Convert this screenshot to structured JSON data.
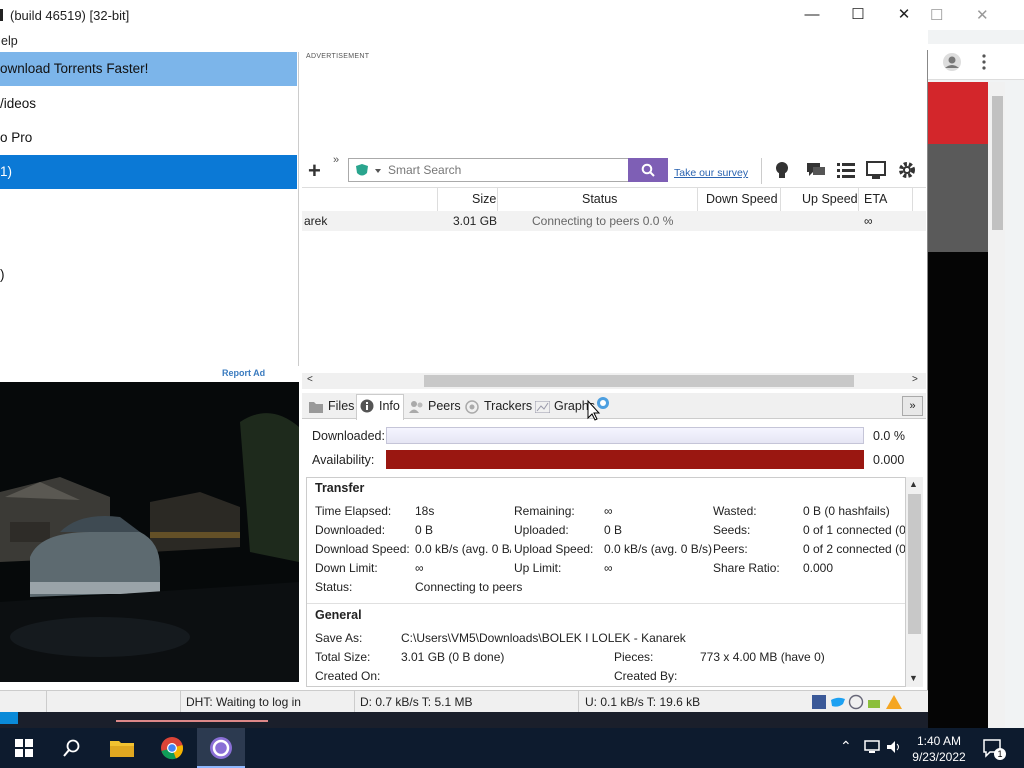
{
  "window": {
    "title": "(build 46519) [32-bit]",
    "minimize": "—",
    "maximize": "☐",
    "close": "✕",
    "menu_help": "Help"
  },
  "sidebar": {
    "items": [
      {
        "label": "ownload Torrents Faster!"
      },
      {
        "label": "/ideos"
      },
      {
        "label": "o Pro"
      },
      {
        "label": "1)"
      },
      {
        "label": ")"
      }
    ],
    "report_ad": "Report Ad"
  },
  "ad": {
    "label": "ADVERTISEMENT"
  },
  "toolbar": {
    "search_placeholder": "Smart Search",
    "survey_link": "Take our survey"
  },
  "torrent_list": {
    "headers": [
      "Size",
      "Status",
      "Down Speed",
      "Up Speed",
      "ETA"
    ],
    "row": {
      "name": "arek",
      "size": "3.01 GB",
      "status": "Connecting to peers 0.0 %",
      "eta": "∞"
    }
  },
  "tabs": {
    "files": "Files",
    "info": "Info",
    "peers": "Peers",
    "trackers": "Trackers",
    "graphs": "Graphs"
  },
  "progress": {
    "downloaded_label": "Downloaded:",
    "downloaded_value": "0.0 %",
    "downloaded_fraction": 0.0,
    "availability_label": "Availability:",
    "availability_value": "0.000"
  },
  "transfer": {
    "heading": "Transfer",
    "time_elapsed_label": "Time Elapsed:",
    "time_elapsed": "18s",
    "downloaded_label": "Downloaded:",
    "downloaded": "0 B",
    "download_speed_label": "Download Speed:",
    "download_speed": "0.0 kB/s (avg. 0 B/s",
    "down_limit_label": "Down Limit:",
    "down_limit": "∞",
    "status_label": "Status:",
    "status": "Connecting to peers",
    "remaining_label": "Remaining:",
    "remaining": "∞",
    "uploaded_label": "Uploaded:",
    "uploaded": "0 B",
    "upload_speed_label": "Upload Speed:",
    "upload_speed": "0.0 kB/s (avg. 0 B/s)",
    "up_limit_label": "Up Limit:",
    "up_limit": "∞",
    "wasted_label": "Wasted:",
    "wasted": "0 B (0 hashfails)",
    "seeds_label": "Seeds:",
    "seeds": "0 of 1 connected (0",
    "peers_label": "Peers:",
    "peers": "0 of 2 connected (0",
    "share_ratio_label": "Share Ratio:",
    "share_ratio": "0.000"
  },
  "general": {
    "heading": "General",
    "save_as_label": "Save As:",
    "save_as": "C:\\Users\\VM5\\Downloads\\BOLEK I LOLEK - Kanarek",
    "total_size_label": "Total Size:",
    "total_size": "3.01 GB (0 B done)",
    "created_on_label": "Created On:",
    "created_on": "",
    "pieces_label": "Pieces:",
    "pieces": "773 x 4.00 MB (have 0)",
    "created_by_label": "Created By:",
    "created_by": ""
  },
  "statusbar": {
    "dht": "DHT: Waiting to log in",
    "down": "D: 0.7 kB/s T: 5.1 MB",
    "up": "U: 0.1 kB/s T: 19.6 kB"
  },
  "taskbar": {
    "time": "1:40 AM",
    "date": "9/23/2022",
    "notification_count": "1"
  },
  "colors": {
    "selected_item": "#0b79d6",
    "highlight_item": "#7cb5ea",
    "availability_bar": "#9a1711",
    "search_button": "#7e5fb5",
    "taskbar": "#0d1b2e"
  }
}
